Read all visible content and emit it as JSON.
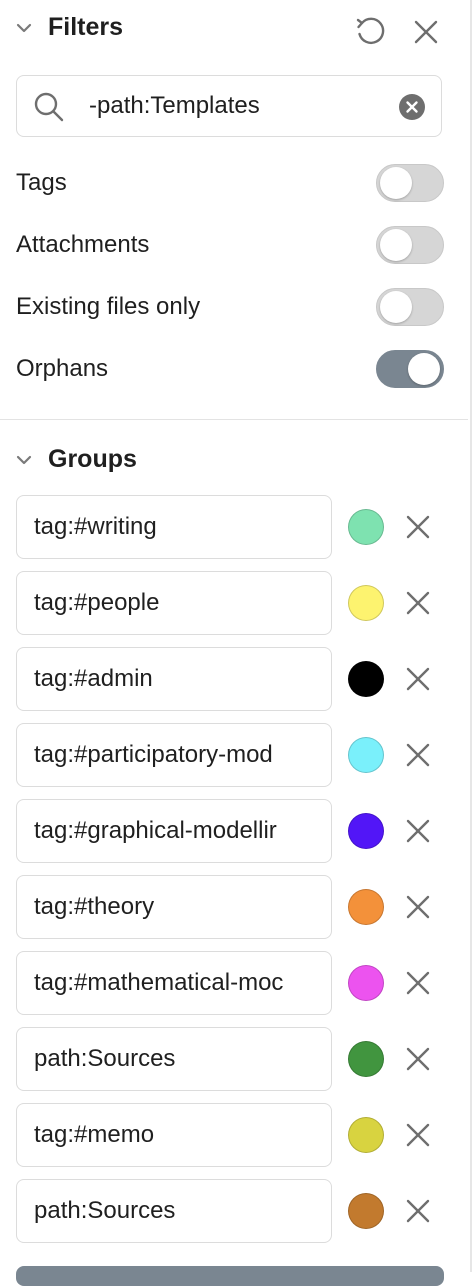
{
  "filters": {
    "title": "Filters",
    "search": {
      "value": "-path:Templates",
      "placeholder": ""
    },
    "toggles": [
      {
        "label": "Tags",
        "on": false
      },
      {
        "label": "Attachments",
        "on": false
      },
      {
        "label": "Existing files only",
        "on": false
      },
      {
        "label": "Orphans",
        "on": true
      }
    ]
  },
  "groups": {
    "title": "Groups",
    "items": [
      {
        "query": "tag:#writing",
        "color": "#7ee2b0"
      },
      {
        "query": "tag:#people",
        "color": "#fdf36f"
      },
      {
        "query": "tag:#admin",
        "color": "#000000"
      },
      {
        "query": "tag:#participatory-mod",
        "color": "#7af0fb"
      },
      {
        "query": "tag:#graphical-modellir",
        "color": "#5216f7"
      },
      {
        "query": "tag:#theory",
        "color": "#f3913a"
      },
      {
        "query": "tag:#mathematical-moc",
        "color": "#ec53ef"
      },
      {
        "query": "path:Sources",
        "color": "#41953f"
      },
      {
        "query": "tag:#memo",
        "color": "#d8d340"
      },
      {
        "query": "path:Sources",
        "color": "#c27a2e"
      }
    ]
  }
}
